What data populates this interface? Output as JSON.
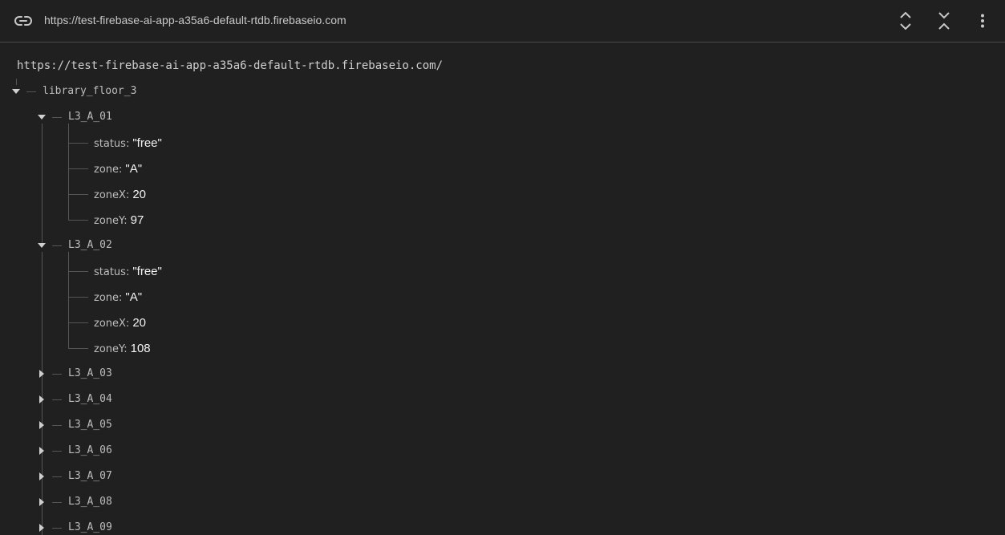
{
  "toolbar": {
    "url": "https://test-firebase-ai-app-a35a6-default-rtdb.firebaseio.com",
    "icons": [
      "link-icon",
      "expand-all-icon",
      "collapse-all-icon",
      "more-vert-icon"
    ]
  },
  "root_url": "https://test-firebase-ai-app-a35a6-default-rtdb.firebaseio.com/",
  "tree": {
    "root": "library_floor_3",
    "l3_a_01": {
      "name": "L3_A_01",
      "fields": [
        {
          "key": "status",
          "value": "\"free\""
        },
        {
          "key": "zone",
          "value": "\"A\""
        },
        {
          "key": "zoneX",
          "value": "20"
        },
        {
          "key": "zoneY",
          "value": "97"
        }
      ]
    },
    "l3_a_02": {
      "name": "L3_A_02",
      "fields": [
        {
          "key": "status",
          "value": "\"free\""
        },
        {
          "key": "zone",
          "value": "\"A\""
        },
        {
          "key": "zoneX",
          "value": "20"
        },
        {
          "key": "zoneY",
          "value": "108"
        }
      ]
    },
    "collapsed": [
      "L3_A_03",
      "L3_A_04",
      "L3_A_05",
      "L3_A_06",
      "L3_A_07",
      "L3_A_08",
      "L3_A_09"
    ]
  }
}
